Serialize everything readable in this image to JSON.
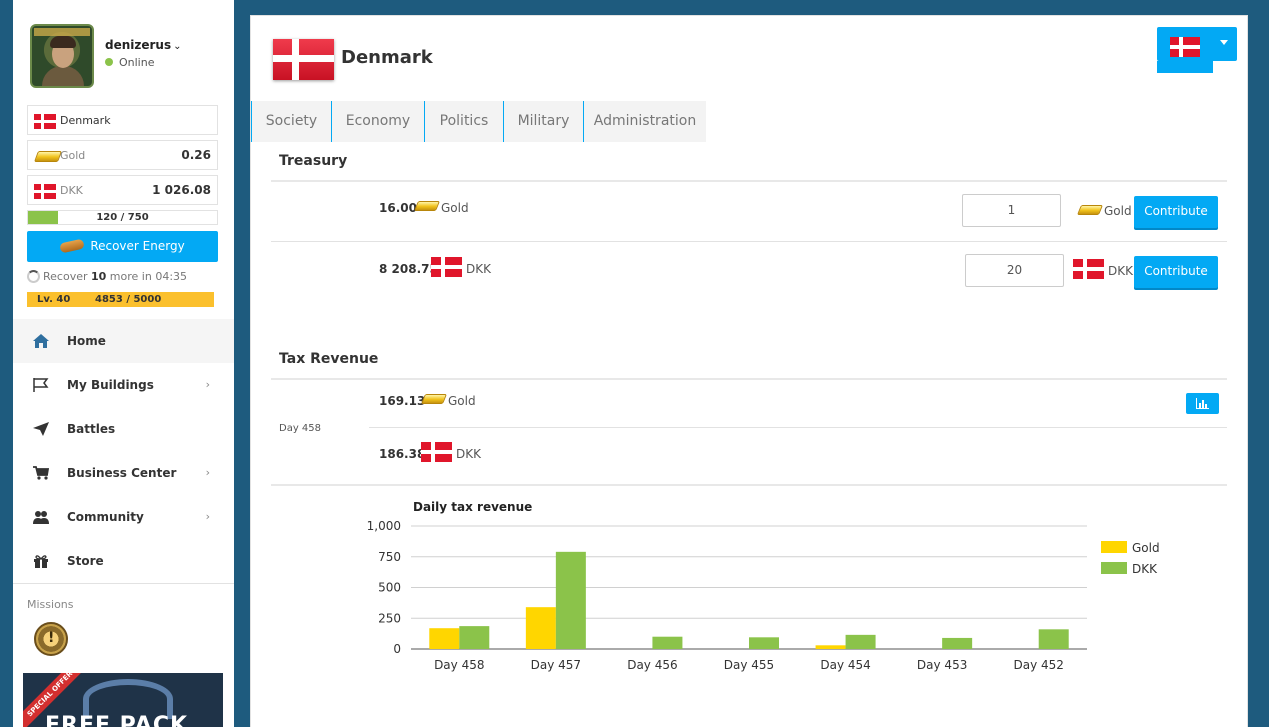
{
  "user": {
    "name": "denizerus",
    "status": "Online"
  },
  "sidebar": {
    "country": "Denmark",
    "gold": {
      "label": "Gold",
      "value": "0.26"
    },
    "currency": {
      "label": "DKK",
      "value": "1 026.08"
    },
    "energy": {
      "text": "120 / 750",
      "progress": 0.16
    },
    "recover_button": "Recover Energy",
    "recover_text": {
      "prefix": "Recover ",
      "amount": "10",
      "suffix": " more in 04:35"
    },
    "level": {
      "label": "Lv. 40",
      "xp": "4853 / 5000"
    },
    "nav": [
      {
        "label": "Home",
        "icon": "home-icon",
        "submenu": false
      },
      {
        "label": "My Buildings",
        "icon": "flag-outline-icon",
        "submenu": true
      },
      {
        "label": "Battles",
        "icon": "paper-plane-icon",
        "submenu": false
      },
      {
        "label": "Business Center",
        "icon": "cart-icon",
        "submenu": true
      },
      {
        "label": "Community",
        "icon": "users-icon",
        "submenu": true
      },
      {
        "label": "Store",
        "icon": "gift-icon",
        "submenu": false
      }
    ],
    "missions_label": "Missions",
    "offer": {
      "ribbon": "SPECIAL OFFER",
      "text": "FREE PACK"
    }
  },
  "header": {
    "country": "Denmark"
  },
  "tabs": [
    "Society",
    "Economy",
    "Politics",
    "Military",
    "Administration"
  ],
  "treasury": {
    "title": "Treasury",
    "rows": [
      {
        "amount": "16.00",
        "unit": "Gold",
        "input": "1",
        "contrib_unit": "Gold",
        "button": "Contribute"
      },
      {
        "amount": "8 208.75",
        "unit": "DKK",
        "input": "20",
        "contrib_unit": "DKK",
        "button": "Contribute"
      }
    ]
  },
  "tax": {
    "title": "Tax Revenue",
    "day": "Day 458",
    "gold": {
      "amount": "169.13",
      "unit": "Gold"
    },
    "dkk": {
      "amount": "186.38",
      "unit": "DKK"
    }
  },
  "colors": {
    "gold_series": "#ffd600",
    "dkk_series": "#8bc34a",
    "accent": "#03a9f4"
  },
  "chart_data": {
    "type": "bar",
    "title": "Daily tax revenue",
    "categories": [
      "Day 458",
      "Day 457",
      "Day 456",
      "Day 455",
      "Day 454",
      "Day 453",
      "Day 452"
    ],
    "series": [
      {
        "name": "Gold",
        "values": [
          169,
          340,
          0,
          0,
          30,
          0,
          0
        ]
      },
      {
        "name": "DKK",
        "values": [
          186,
          790,
          100,
          95,
          115,
          90,
          160
        ]
      }
    ],
    "yticks": [
      "0",
      "250",
      "500",
      "750",
      "1,000"
    ],
    "ylim": [
      0,
      1000
    ],
    "grid": true,
    "legend": "right"
  }
}
